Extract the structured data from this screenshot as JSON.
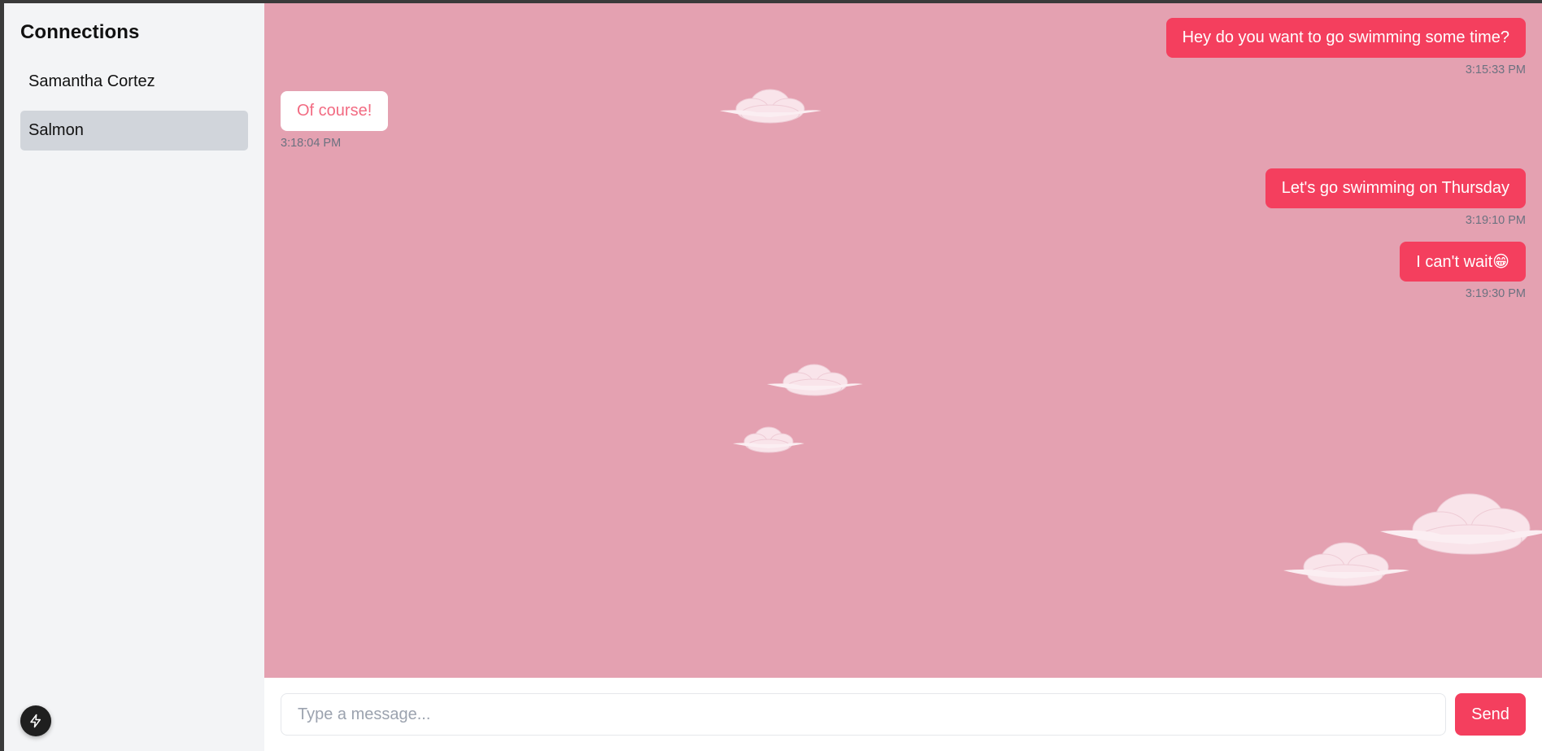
{
  "sidebar": {
    "title": "Connections",
    "items": [
      {
        "label": "Samantha Cortez"
      },
      {
        "label": "Salmon"
      }
    ],
    "bolt_icon": "bolt-icon"
  },
  "chat": {
    "messages": [
      {
        "sender": "me",
        "text": "Hey do you want to go swimming some time?",
        "time": "3:15:33 PM"
      },
      {
        "sender": "them",
        "text": "Of course!",
        "time": "3:18:04 PM"
      },
      {
        "sender": "me",
        "text": "Let's go swimming on Thursday",
        "time": "3:19:10 PM"
      },
      {
        "sender": "me",
        "text": "I can't wait😁",
        "time": "3:19:30 PM"
      }
    ]
  },
  "composer": {
    "placeholder": "Type a message...",
    "send_label": "Send"
  },
  "colors": {
    "accent": "#f43f5e",
    "chat_background": "#e4a1b1",
    "sidebar_background": "#f3f4f6",
    "active_item": "#d1d5db"
  }
}
